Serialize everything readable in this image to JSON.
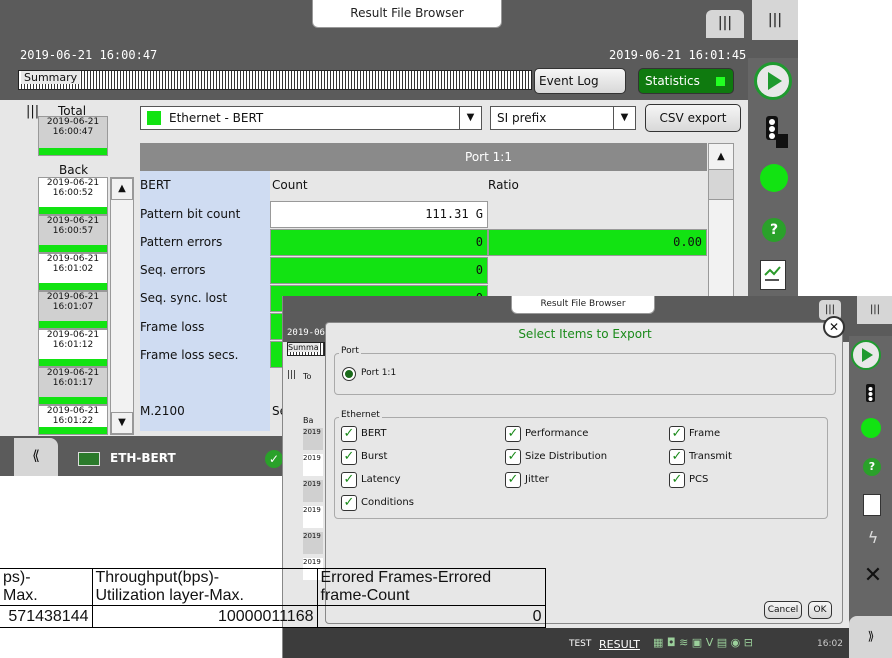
{
  "main": {
    "title": "Result File Browser",
    "start_time": "2019-06-21 16:00:47",
    "end_time": "2019-06-21 16:01:45",
    "summary_label": "Summary",
    "event_log_label": "Event Log",
    "statistics_label": "Statistics",
    "total_label": "Total",
    "total_time": [
      "2019-06-21",
      "16:00:47"
    ],
    "back_label": "Back",
    "interface_select": "Ethernet - BERT",
    "prefix_select": "SI prefix",
    "csv_export_label": "CSV export",
    "port_header": "Port 1:1",
    "col_bert": "BERT",
    "col_count": "Count",
    "col_ratio": "Ratio",
    "rows": [
      {
        "label": "Pattern bit count",
        "count": "111.31 G",
        "ratio": ""
      },
      {
        "label": "Pattern errors",
        "count": "0",
        "ratio": "0.00"
      },
      {
        "label": "Seq. errors",
        "count": "0",
        "ratio": ""
      },
      {
        "label": "Seq. sync. lost",
        "count": "0",
        "ratio": ""
      },
      {
        "label": "Frame loss",
        "count": "",
        "ratio": ""
      },
      {
        "label": "Frame loss secs.",
        "count": "",
        "ratio": ""
      }
    ],
    "m2100_label": "M.2100",
    "m2100_trunc": "Se",
    "time_slots": [
      [
        "2019-06-21",
        "16:00:52"
      ],
      [
        "2019-06-21",
        "16:00:57"
      ],
      [
        "2019-06-21",
        "16:01:02"
      ],
      [
        "2019-06-21",
        "16:01:07"
      ],
      [
        "2019-06-21",
        "16:01:12"
      ],
      [
        "2019-06-21",
        "16:01:17"
      ],
      [
        "2019-06-21",
        "16:01:22"
      ]
    ],
    "bottom_label": "ETH-BERT"
  },
  "dialog": {
    "window_title": "Result File Browser",
    "title": "Select Items to Export",
    "port_group_label": "Port",
    "port_option": "Port 1:1",
    "ethernet_group_label": "Ethernet",
    "items": [
      "BERT",
      "Performance",
      "Frame",
      "Burst",
      "Size Distribution",
      "Transmit",
      "Latency",
      "Jitter",
      "PCS",
      "Conditions"
    ],
    "cancel_label": "Cancel",
    "ok_label": "OK",
    "bg_clock": "2019-06",
    "bg_summary": "Summa",
    "bg_total": "To",
    "bg_back": "Ba",
    "bg_slots": [
      "2019",
      "2019",
      "2019",
      "2019",
      "2019",
      "2019"
    ]
  },
  "status_bar": {
    "test": "TEST",
    "result": "RESULT",
    "time": "16:02"
  },
  "table": {
    "headers": [
      [
        "ps)-",
        "Max."
      ],
      [
        "Throughput(bps)-",
        "Utilization layer-Max."
      ],
      [
        "Errored Frames-Errored",
        "frame-Count"
      ]
    ],
    "row": [
      "571438144",
      "10000011168",
      "0"
    ]
  },
  "colors": {
    "accent_green": "#12e312",
    "chrome_dark": "#5b5b5b",
    "header_gray": "#8a8a8a",
    "label_blue": "#cfdcf2"
  }
}
